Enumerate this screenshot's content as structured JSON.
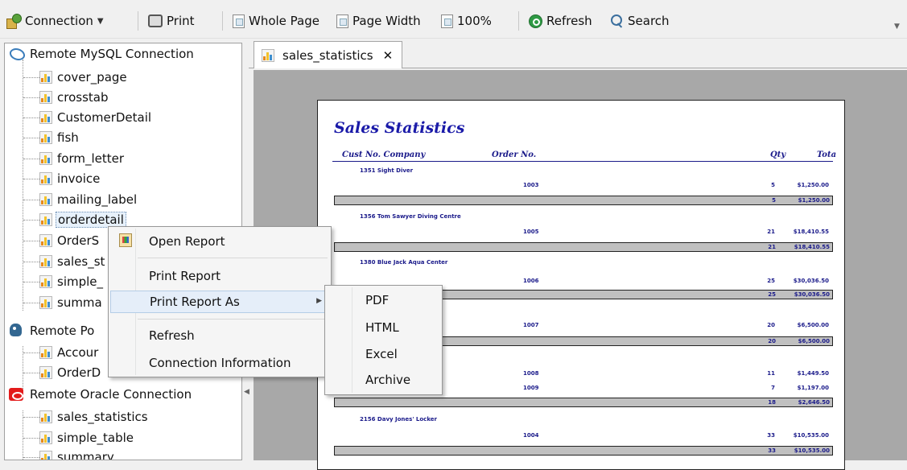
{
  "toolbar": {
    "connection_label": "Connection",
    "print_label": "Print",
    "whole_page_label": "Whole Page",
    "page_width_label": "Page Width",
    "zoom_label": "100%",
    "refresh_label": "Refresh",
    "search_label": "Search"
  },
  "tree": {
    "mysql": {
      "label": "Remote MySQL Connection",
      "items": [
        "cover_page",
        "crosstab",
        "CustomerDetail",
        "fish",
        "form_letter",
        "invoice",
        "mailing_label",
        "orderdetail",
        "OrderS",
        "sales_st",
        "simple_",
        "summa"
      ]
    },
    "postgres": {
      "label": "Remote Po",
      "items": [
        "Accour",
        "OrderD"
      ]
    },
    "oracle": {
      "label": "Remote Oracle Connection",
      "items": [
        "sales_statistics",
        "simple_table",
        "summary"
      ]
    },
    "selected": "orderdetail"
  },
  "tab": {
    "label": "sales_statistics",
    "close": "✕"
  },
  "report": {
    "title": "Sales Statistics",
    "headers": {
      "cust": "Cust No. Company",
      "order": "Order No.",
      "qty": "Qty",
      "total": "Tota"
    },
    "groups": [
      {
        "customer": "1351 Sight Diver",
        "rows": [
          {
            "order": "1003",
            "qty": "5",
            "total": "$1,250.00"
          }
        ],
        "sum_qty": "5",
        "sum_total": "$1,250.00"
      },
      {
        "customer": "1356 Tom Sawyer Diving Centre",
        "rows": [
          {
            "order": "1005",
            "qty": "21",
            "total": "$18,410.55"
          }
        ],
        "sum_qty": "21",
        "sum_total": "$18,410.55"
      },
      {
        "customer": "1380 Blue Jack Aqua Center",
        "rows": [
          {
            "order": "1006",
            "qty": "25",
            "total": "$30,036.50"
          }
        ],
        "sum_qty": "25",
        "sum_total": "$30,036.50"
      },
      {
        "customer": "",
        "rows": [
          {
            "order": "1007",
            "qty": "20",
            "total": "$6,500.00"
          }
        ],
        "sum_qty": "20",
        "sum_total": "$6,500.00"
      },
      {
        "customer": "",
        "rows": [
          {
            "order": "1008",
            "qty": "11",
            "total": "$1,449.50"
          },
          {
            "order": "1009",
            "qty": "7",
            "total": "$1,197.00"
          }
        ],
        "sum_qty": "18",
        "sum_total": "$2,646.50"
      },
      {
        "customer": "2156 Davy Jones' Locker",
        "rows": [
          {
            "order": "1004",
            "qty": "33",
            "total": "$10,535.00"
          }
        ],
        "sum_qty": "33",
        "sum_total": "$10,535.00"
      }
    ]
  },
  "context_menu": {
    "items": [
      "Open Report",
      "Print Report",
      "Print Report As",
      "Refresh",
      "Connection Information"
    ],
    "highlighted": "Print Report As"
  },
  "submenu": {
    "items": [
      "PDF",
      "HTML",
      "Excel",
      "Archive"
    ]
  }
}
